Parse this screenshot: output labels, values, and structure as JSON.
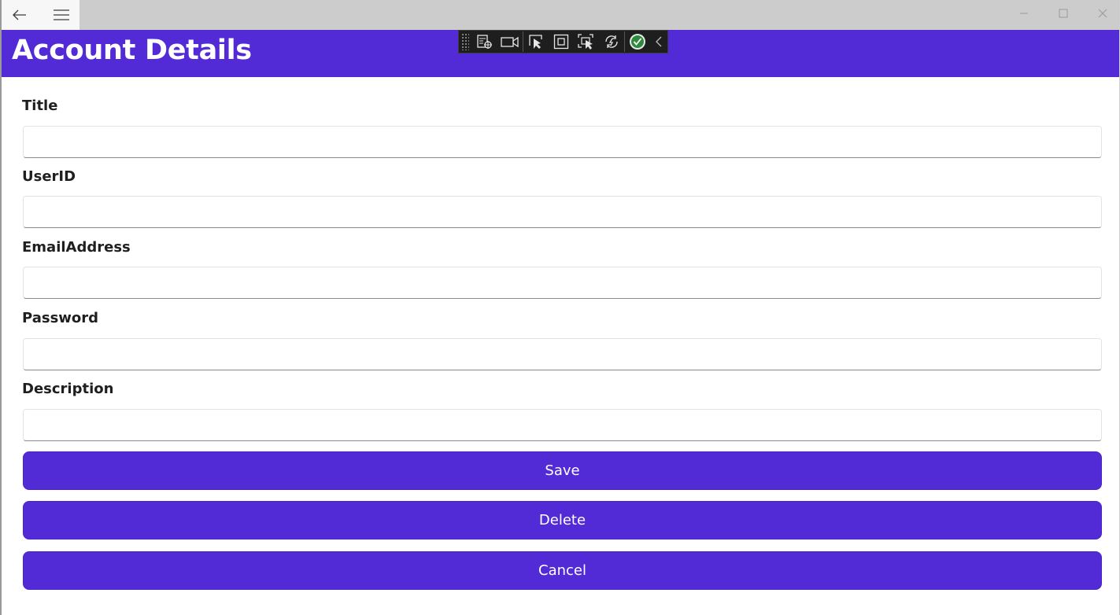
{
  "titlebar": {
    "back_icon": "arrow-left-icon",
    "menu_icon": "hamburger-menu-icon",
    "minimize_icon": "minimize-icon",
    "maximize_icon": "maximize-icon",
    "close_icon": "close-icon"
  },
  "header": {
    "title": "Account Details",
    "background": "#522bd6"
  },
  "debug_toolbar": {
    "icons": [
      "live-visual-tree-icon",
      "video-capture-icon",
      "select-element-icon",
      "display-layout-adorners-icon",
      "track-focus-icon",
      "hot-reload-icon",
      "checkmark-icon",
      "collapse-chevron-icon"
    ]
  },
  "form": {
    "fields": [
      {
        "label": "Title",
        "value": ""
      },
      {
        "label": "UserID",
        "value": ""
      },
      {
        "label": "EmailAddress",
        "value": ""
      },
      {
        "label": "Password",
        "value": ""
      },
      {
        "label": "Description",
        "value": ""
      }
    ]
  },
  "actions": {
    "save_label": "Save",
    "delete_label": "Delete",
    "cancel_label": "Cancel",
    "button_color": "#522bd6"
  }
}
